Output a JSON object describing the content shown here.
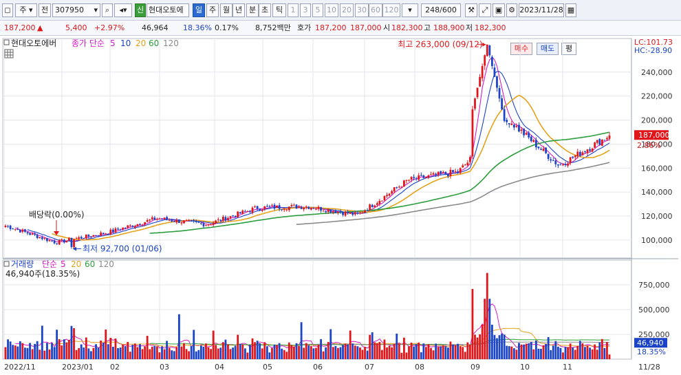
{
  "toolbar": {
    "market": "주",
    "prefix": "전",
    "code": "307950",
    "new_badge": "신",
    "stock_name": "현대오토에",
    "periods": [
      "일",
      "주",
      "월",
      "년",
      "분",
      "초",
      "틱"
    ],
    "active_period": "일",
    "intervals": [
      "1",
      "3",
      "5",
      "10",
      "20",
      "30",
      "60",
      "120"
    ],
    "count": "248",
    "count_total": "/600",
    "date": "2023/11/28"
  },
  "quote": {
    "price": "187,200",
    "change_arrow": "▲",
    "change": "5,400",
    "change_pct": "+2.97%",
    "volume": "46,964",
    "turnover_pct": "18.36%",
    "pct2": "0.17%",
    "amount": "8,752백만",
    "hoga_label": "호가",
    "ask": "187,200",
    "bid": "187,000",
    "open_label": "시",
    "open": "182,300",
    "high_label": "고",
    "high": "188,900",
    "low_label": "저",
    "low": "182,300",
    "buy_label": "매수",
    "sell_label": "매도",
    "eval_label": "평"
  },
  "price_panel": {
    "legend_name": "현대오토에버",
    "legend_type": "종가 단순",
    "ma_labels": [
      "5",
      "10",
      "20",
      "60",
      "120"
    ],
    "lc": "LC:101.73",
    "hc": "HC:-28.90",
    "high_annotation": "최고 263,000 (09/12)",
    "low_annotation": "최저 92,700 (01/06)",
    "dividend_annotation": "배당락(0.00%)",
    "current_price_tag": "187,000",
    "current_pct_tag": "2.86%"
  },
  "volume_panel": {
    "legend_name": "거래량",
    "legend_type": "단순",
    "ma_labels": [
      "5",
      "20",
      "60",
      "120"
    ],
    "current_value_label": "46,940주(18.35%)",
    "current_tag": "46,940",
    "current_pct_tag": "18.35%"
  },
  "colors": {
    "up": "#e0161b",
    "down": "#1a43c8",
    "ma5": "#d61ac8",
    "ma10": "#1a43c8",
    "ma20": "#e5a21a",
    "ma60": "#2a9d3a",
    "ma120": "#8a8a8a",
    "tag_bg": "#e0161b",
    "vol_tag_bg": "#1a43c8"
  },
  "chart_data": {
    "type": "candlestick",
    "period": "daily",
    "x_ticks": [
      "2022/11",
      "2023/01",
      "02",
      "03",
      "04",
      "05",
      "06",
      "07",
      "08",
      "09",
      "10",
      "11",
      "11/28"
    ],
    "y_ticks": [
      100000,
      120000,
      140000,
      160000,
      180000,
      200000,
      220000,
      240000
    ],
    "y_range": [
      85000,
      268000
    ],
    "monthly_closes": [
      {
        "month": "2022/11",
        "close": 112000
      },
      {
        "month": "2022/12",
        "close": 98000
      },
      {
        "month": "2023/01",
        "close": 106000
      },
      {
        "month": "2023/02",
        "close": 118000
      },
      {
        "month": "2023/03",
        "close": 113000
      },
      {
        "month": "2023/04",
        "close": 127000
      },
      {
        "month": "2023/05",
        "close": 128000
      },
      {
        "month": "2023/06",
        "close": 121000
      },
      {
        "month": "2023/07",
        "close": 150000
      },
      {
        "month": "2023/08",
        "close": 157000
      },
      {
        "month": "2023/09",
        "close": 200000
      },
      {
        "month": "2023/10",
        "close": 162000
      },
      {
        "month": "2023/11",
        "close": 187200
      }
    ],
    "extremes": {
      "high": 263000,
      "high_date": "09/12",
      "low": 92700,
      "low_date": "01/06"
    },
    "volume": {
      "y_ticks": [
        250000,
        500000,
        750000
      ],
      "y_range": [
        0,
        930000
      ],
      "peak": 870000,
      "last": 46940
    }
  }
}
